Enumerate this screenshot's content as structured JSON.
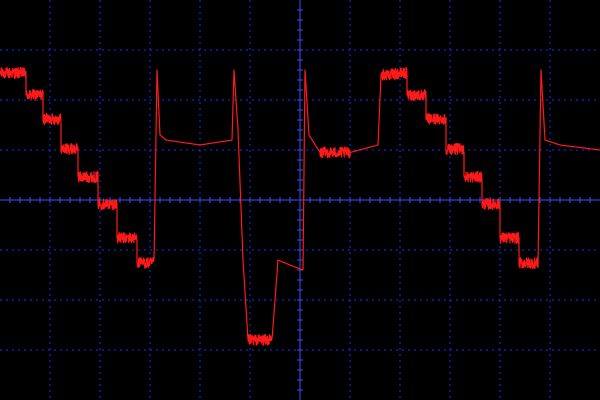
{
  "chart_data": {
    "type": "line",
    "title": "",
    "xlabel": "",
    "ylabel": "",
    "xlim": [
      0,
      12
    ],
    "ylim": [
      -4,
      4
    ],
    "grid": true,
    "grid_divisions": {
      "x": 12,
      "y": 8
    },
    "colors": {
      "background": "#000000",
      "grid": "#1c2cff",
      "axis": "#3a4dff",
      "trace": "#ff1a1a"
    },
    "series": [
      {
        "noise": 0.22,
        "points": [
          [
            0.0,
            2.54
          ],
          [
            0.52,
            2.54
          ],
          [
            0.52,
            2.1
          ],
          [
            0.86,
            2.1
          ],
          [
            0.86,
            1.62
          ],
          [
            1.22,
            1.62
          ],
          [
            1.22,
            1.02
          ],
          [
            1.56,
            1.02
          ],
          [
            1.56,
            0.46
          ],
          [
            1.96,
            0.46
          ],
          [
            1.96,
            -0.08
          ],
          [
            2.34,
            -0.08
          ],
          [
            2.34,
            -0.76
          ],
          [
            2.74,
            -0.76
          ],
          [
            2.74,
            -1.26
          ],
          [
            3.08,
            -1.26
          ],
          [
            3.14,
            2.6
          ],
          [
            3.2,
            1.3
          ],
          [
            3.32,
            1.2
          ],
          [
            4.0,
            1.1
          ],
          [
            4.64,
            1.2
          ],
          [
            4.68,
            2.6
          ],
          [
            4.76,
            1.4
          ],
          [
            4.86,
            -1.2
          ],
          [
            4.96,
            -2.8
          ],
          [
            5.4,
            -2.8
          ],
          [
            5.44,
            -2.8
          ],
          [
            5.56,
            -1.2
          ],
          [
            5.8,
            -1.3
          ],
          [
            6.06,
            -1.4
          ],
          [
            6.1,
            2.6
          ],
          [
            6.18,
            1.3
          ],
          [
            6.4,
            0.95
          ],
          [
            7.0,
            0.95
          ],
          [
            7.56,
            1.1
          ],
          [
            7.62,
            2.5
          ],
          [
            8.14,
            2.54
          ],
          [
            8.14,
            2.1
          ],
          [
            8.52,
            2.1
          ],
          [
            8.52,
            1.62
          ],
          [
            8.92,
            1.62
          ],
          [
            8.92,
            1.02
          ],
          [
            9.28,
            1.02
          ],
          [
            9.28,
            0.46
          ],
          [
            9.64,
            0.46
          ],
          [
            9.64,
            -0.08
          ],
          [
            10.0,
            -0.08
          ],
          [
            10.0,
            -0.76
          ],
          [
            10.38,
            -0.76
          ],
          [
            10.38,
            -1.26
          ],
          [
            10.76,
            -1.26
          ],
          [
            10.82,
            2.6
          ],
          [
            10.9,
            1.2
          ],
          [
            11.2,
            1.1
          ],
          [
            12.0,
            1.0
          ]
        ]
      }
    ]
  }
}
